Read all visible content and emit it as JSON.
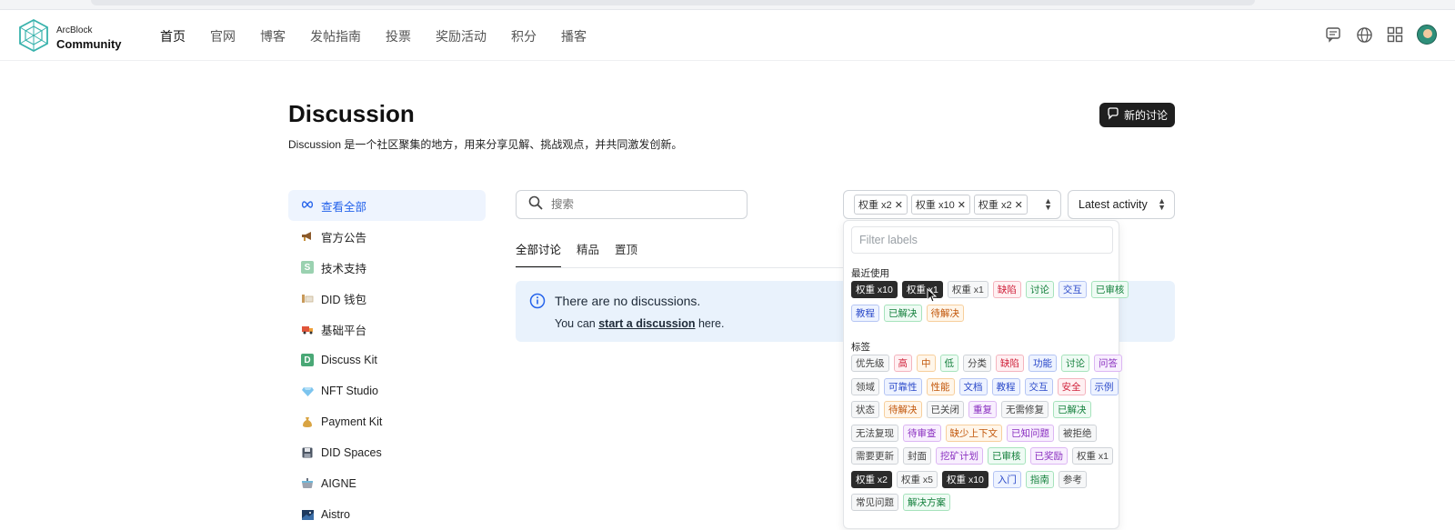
{
  "brand": {
    "line1": "ArcBlock",
    "line2": "Community"
  },
  "nav": [
    "首页",
    "官网",
    "博客",
    "发帖指南",
    "投票",
    "奖励活动",
    "积分",
    "播客"
  ],
  "header_icons": [
    "chat-icon",
    "globe-icon",
    "apps-grid-icon",
    "user-avatar"
  ],
  "page": {
    "title": "Discussion",
    "subtitle": "Discussion 是一个社区聚集的地方，用来分享见解、挑战观点，并共同激发创新。",
    "new_button": "新的讨论"
  },
  "sidebar": [
    {
      "label": "查看全部",
      "icon": "infinity-icon",
      "active": true
    },
    {
      "label": "官方公告",
      "icon": "megaphone-icon"
    },
    {
      "label": "技术支持",
      "icon": "s-badge-icon"
    },
    {
      "label": "DID 钱包",
      "icon": "wallet-icon"
    },
    {
      "label": "基础平台",
      "icon": "truck-icon"
    },
    {
      "label": "Discuss Kit",
      "icon": "d-badge-icon"
    },
    {
      "label": "NFT Studio",
      "icon": "gem-icon"
    },
    {
      "label": "Payment Kit",
      "icon": "money-bag-icon"
    },
    {
      "label": "DID Spaces",
      "icon": "floppy-icon"
    },
    {
      "label": "AIGNE",
      "icon": "pot-icon"
    },
    {
      "label": "Aistro",
      "icon": "night-sky-icon"
    }
  ],
  "search": {
    "placeholder": "搜索"
  },
  "tabs": [
    "全部讨论",
    "精品",
    "置顶"
  ],
  "empty": {
    "title": "There are no discussions.",
    "prefix": "You can ",
    "link": "start a discussion",
    "suffix": " here."
  },
  "selected_labels": [
    "权重 x2",
    "权重 x10",
    "权重 x2"
  ],
  "sort": "Latest activity",
  "dropdown": {
    "filter_placeholder": "Filter labels",
    "recent_title": "最近使用",
    "recent": [
      [
        {
          "t": "权重 x10",
          "c": "dark"
        },
        {
          "t": "权重 x1",
          "c": "dark"
        },
        {
          "t": "权重 x1",
          "c": "gray"
        },
        {
          "t": "缺陷",
          "c": "red"
        },
        {
          "t": "讨论",
          "c": "green"
        },
        {
          "t": "交互",
          "c": "blue"
        },
        {
          "t": "已审核",
          "c": "green"
        }
      ],
      [
        {
          "t": "教程",
          "c": "blue"
        },
        {
          "t": "已解决",
          "c": "green"
        },
        {
          "t": "待解决",
          "c": "orange"
        }
      ]
    ],
    "tags_title": "标签",
    "tags": [
      [
        {
          "t": "优先级",
          "c": "gray"
        },
        {
          "t": "高",
          "c": "red"
        },
        {
          "t": "中",
          "c": "orange"
        },
        {
          "t": "低",
          "c": "green"
        },
        {
          "t": "分类",
          "c": "gray"
        },
        {
          "t": "缺陷",
          "c": "red"
        },
        {
          "t": "功能",
          "c": "blue"
        },
        {
          "t": "讨论",
          "c": "green"
        },
        {
          "t": "问答",
          "c": "purple"
        }
      ],
      [
        {
          "t": "领域",
          "c": "gray"
        },
        {
          "t": "可靠性",
          "c": "blue"
        },
        {
          "t": "性能",
          "c": "orange"
        },
        {
          "t": "文档",
          "c": "blue"
        },
        {
          "t": "教程",
          "c": "blue"
        },
        {
          "t": "交互",
          "c": "blue"
        },
        {
          "t": "安全",
          "c": "red"
        },
        {
          "t": "示例",
          "c": "blue"
        }
      ],
      [
        {
          "t": "状态",
          "c": "gray"
        },
        {
          "t": "待解决",
          "c": "orange"
        },
        {
          "t": "已关闭",
          "c": "gray"
        },
        {
          "t": "重复",
          "c": "purple"
        },
        {
          "t": "无需修复",
          "c": "gray"
        },
        {
          "t": "已解决",
          "c": "green"
        }
      ],
      [
        {
          "t": "无法复现",
          "c": "gray"
        },
        {
          "t": "待审查",
          "c": "purple"
        },
        {
          "t": "缺少上下文",
          "c": "orange"
        },
        {
          "t": "已知问题",
          "c": "purple"
        },
        {
          "t": "被拒绝",
          "c": "gray"
        }
      ],
      [
        {
          "t": "需要更新",
          "c": "gray"
        },
        {
          "t": "封面",
          "c": "gray"
        },
        {
          "t": "挖矿计划",
          "c": "purple"
        },
        {
          "t": "已审核",
          "c": "green"
        },
        {
          "t": "已奖励",
          "c": "purple"
        },
        {
          "t": "权重 x1",
          "c": "gray"
        }
      ],
      [
        {
          "t": "权重 x2",
          "c": "dark"
        },
        {
          "t": "权重 x5",
          "c": "gray"
        },
        {
          "t": "权重 x10",
          "c": "dark"
        },
        {
          "t": "入门",
          "c": "blue"
        },
        {
          "t": "指南",
          "c": "green"
        },
        {
          "t": "参考",
          "c": "gray"
        }
      ],
      [
        {
          "t": "常见问题",
          "c": "gray"
        },
        {
          "t": "解决方案",
          "c": "green"
        }
      ]
    ]
  },
  "colors": {
    "dark": {
      "bg": "#2b2b2b",
      "fg": "#ffffff",
      "bd": "#2b2b2b"
    },
    "gray": {
      "bg": "#f6f7f8",
      "fg": "#444444",
      "bd": "#cfd3d8"
    },
    "red": {
      "bg": "#fff0f2",
      "fg": "#d0243d",
      "bd": "#f4b4be"
    },
    "green": {
      "bg": "#effbf4",
      "fg": "#15803d",
      "bd": "#a6e3bc"
    },
    "blue": {
      "bg": "#eef3ff",
      "fg": "#2948c9",
      "bd": "#b5c5f4"
    },
    "orange": {
      "bg": "#fff6ea",
      "fg": "#c2570b",
      "bd": "#f7cf9c"
    },
    "purple": {
      "bg": "#f8effe",
      "fg": "#8a2fc0",
      "bd": "#dcb6f3"
    }
  }
}
